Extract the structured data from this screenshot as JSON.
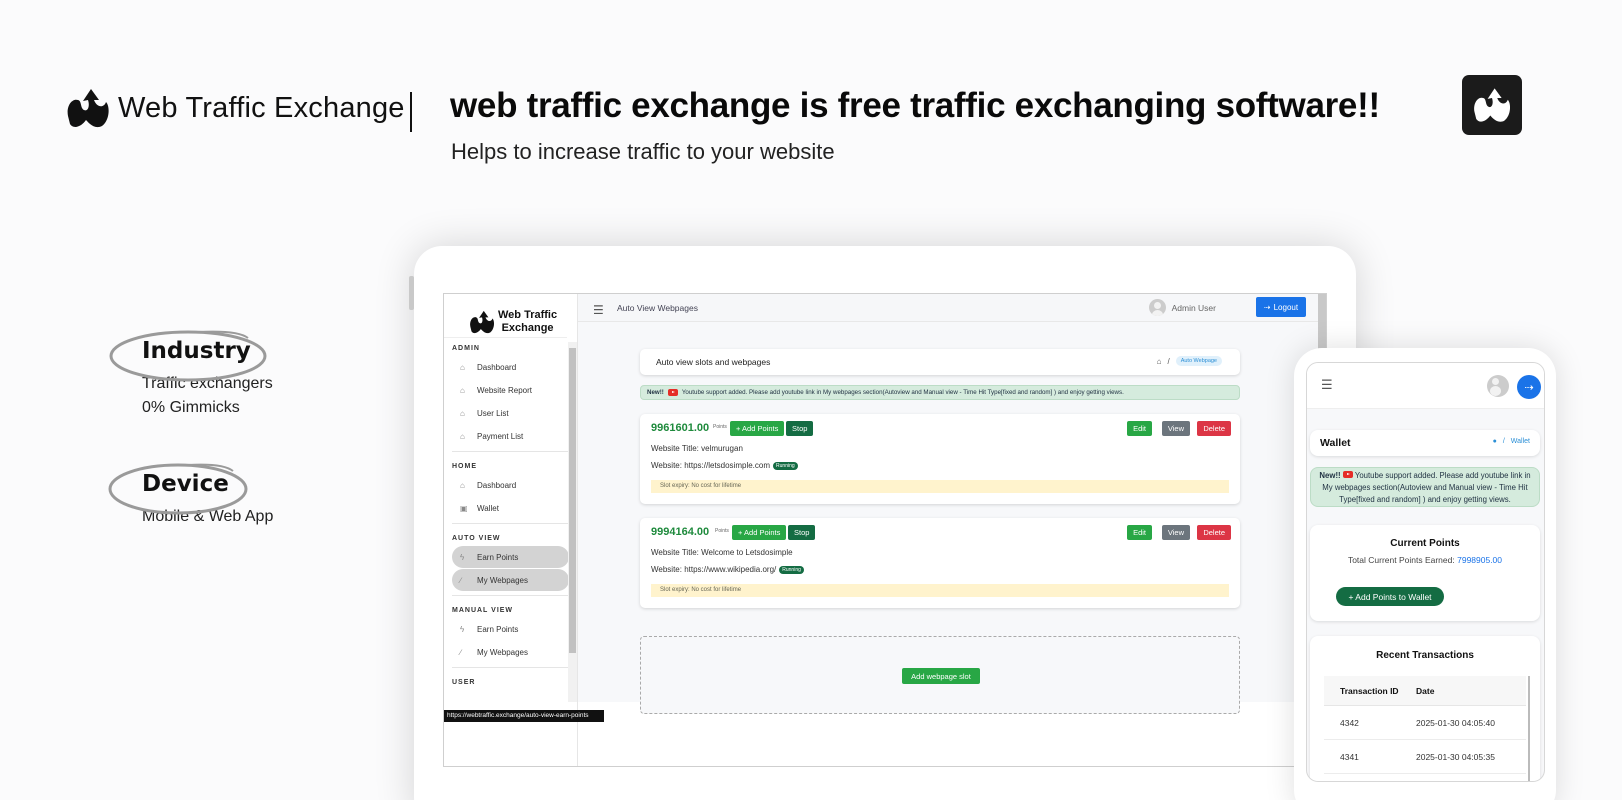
{
  "header": {
    "brand": "Web Traffic Exchange",
    "headline": "web traffic exchange is free traffic exchanging software!!",
    "subheadline": "Helps to increase traffic to your website"
  },
  "features": [
    {
      "title": "Industry",
      "lines": [
        "Traffic exchangers",
        "0% Gimmicks"
      ]
    },
    {
      "title": "Device",
      "lines": [
        "Mobile & Web App"
      ]
    }
  ],
  "app": {
    "logo_line1": "Web Traffic",
    "logo_line2": "Exchange",
    "sidebar": {
      "sections": [
        {
          "label": "ADMIN",
          "items": [
            {
              "label": "Dashboard",
              "icon": "home-icon"
            },
            {
              "label": "Website Report",
              "icon": "home-icon"
            },
            {
              "label": "User List",
              "icon": "home-icon"
            },
            {
              "label": "Payment List",
              "icon": "home-icon"
            }
          ]
        },
        {
          "label": "HOME",
          "items": [
            {
              "label": "Dashboard",
              "icon": "home-icon"
            },
            {
              "label": "Wallet",
              "icon": "wallet-icon"
            }
          ]
        },
        {
          "label": "AUTO VIEW",
          "items": [
            {
              "label": "Earn Points",
              "icon": "bolt-icon",
              "active": true
            },
            {
              "label": "My Webpages",
              "icon": "link-icon",
              "active": true
            }
          ]
        },
        {
          "label": "MANUAL VIEW",
          "items": [
            {
              "label": "Earn Points",
              "icon": "bolt-icon"
            },
            {
              "label": "My Webpages",
              "icon": "link-icon"
            }
          ]
        },
        {
          "label": "USER",
          "items": []
        }
      ]
    },
    "topbar": {
      "title": "Auto View Webpages",
      "user": "Admin User",
      "logout": "Logout"
    },
    "breadcrumb": {
      "title": "Auto view slots and webpages",
      "separator": "/",
      "current": "Auto Webpage"
    },
    "notice": {
      "new": "New!!",
      "text": "Youtube support added. Please add youtube link in My webpages section(Autoview and Manual view - Time Hit Type[fixed and random] ) and enjoy getting views."
    },
    "slots": [
      {
        "points": "9961601.00",
        "points_label": "Points",
        "add": "+ Add Points",
        "stop": "Stop",
        "edit": "Edit",
        "view": "View",
        "delete": "Delete",
        "title": "Website Title: velmurugan",
        "website": "Website: https://letsdosimple.com",
        "status": "Running",
        "expiry": "Slot expiry: No cost for lifetime"
      },
      {
        "points": "9994164.00",
        "points_label": "Points",
        "add": "+ Add Points",
        "stop": "Stop",
        "edit": "Edit",
        "view": "View",
        "delete": "Delete",
        "title": "Website Title: Welcome to Letsdosimple",
        "website": "Website: https://www.wikipedia.org/",
        "status": "Running",
        "expiry": "Slot expiry: No cost for lifetime"
      }
    ],
    "add_slot": "Add webpage slot",
    "status_url": "https://webtraffic.exchange/auto-view-earn-points"
  },
  "mobile": {
    "wallet_title": "Wallet",
    "breadcrumb_sep": "/",
    "breadcrumb_current": "Wallet",
    "notice_new": "New!!",
    "notice_text": "Youtube support added. Please add youtube link in My webpages section(Autoview and Manual view - Time Hit Type[fixed and random] ) and enjoy getting views.",
    "points_title": "Current Points",
    "points_label": "Total Current Points Earned:",
    "points_value": "7998905.00",
    "add_button": "+ Add Points to Wallet",
    "tx_title": "Recent Transactions",
    "tx_headers": [
      "Transaction ID",
      "Date"
    ],
    "tx_rows": [
      [
        "4342",
        "2025-01-30 04:05:40"
      ],
      [
        "4341",
        "2025-01-30 04:05:35"
      ]
    ]
  }
}
